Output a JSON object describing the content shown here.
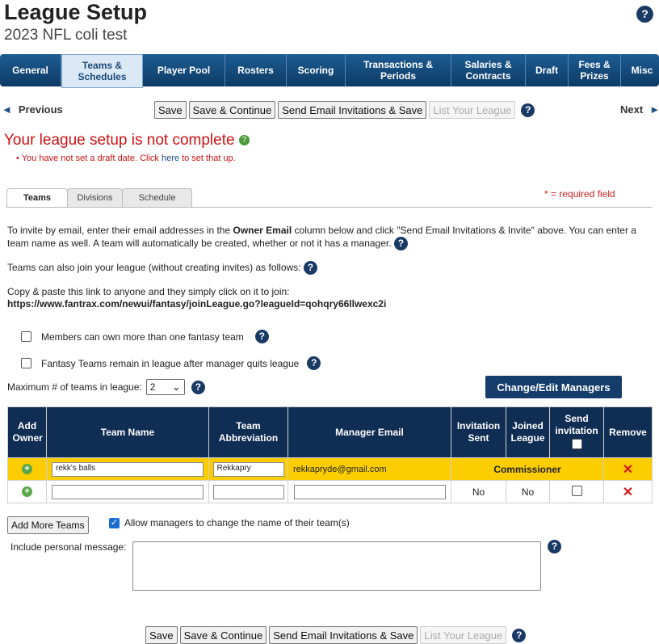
{
  "header": {
    "title": "League Setup",
    "subtitle": "2023 NFL coli test"
  },
  "icons": {
    "help": "?",
    "ok": "?",
    "plus": "+",
    "remove": "✕",
    "prev_arrow": "◄",
    "next_arrow": "►",
    "dropdown": "⌄"
  },
  "nav": [
    {
      "label": "General",
      "active": false
    },
    {
      "label": "Teams & Schedules",
      "active": true
    },
    {
      "label": "Player Pool",
      "active": false
    },
    {
      "label": "Rosters",
      "active": false
    },
    {
      "label": "Scoring",
      "active": false
    },
    {
      "label": "Transactions & Periods",
      "active": false
    },
    {
      "label": "Salaries & Contracts",
      "active": false
    },
    {
      "label": "Draft",
      "active": false
    },
    {
      "label": "Fees & Prizes",
      "active": false
    },
    {
      "label": "Misc",
      "active": false
    }
  ],
  "actions": {
    "previous": "Previous",
    "next": "Next",
    "save": "Save",
    "save_continue": "Save & Continue",
    "send_email": "Send Email Invitations & Save",
    "list_league": "List Your League"
  },
  "error": {
    "title": "Your league setup is not complete",
    "item_pre": "You have not set a draft date. Click",
    "item_link": "here",
    "item_post": "to set that up."
  },
  "tabs": [
    {
      "label": "Teams"
    },
    {
      "label": "Divisions"
    },
    {
      "label": "Schedule"
    }
  ],
  "required_note": "* = required field",
  "info": {
    "p1_pre": "To invite by email, enter their email addresses in the",
    "p1_bold": "Owner Email",
    "p1_mid": "column below and click \"Send Email Invitations & Invite\" above. You can enter a",
    "p1_line2": "team name as well. A team will automatically be created, whether or not it has a manager.",
    "p2": "Teams can also join your league (without creating invites) as follows:",
    "p3": "Copy & paste this link to anyone and they simply click on it to join:",
    "link": "https://www.fantrax.com/newui/fantasy/joinLeague.go?leagueId=qohqry66llwexc2i"
  },
  "options": {
    "multi_team": "Members can own more than one fantasy team",
    "remain": "Fantasy Teams remain in league after manager quits league"
  },
  "max_teams": {
    "label": "Maximum # of teams in league:",
    "value": "2"
  },
  "managers_button": "Change/Edit Managers",
  "table": {
    "headers": {
      "add_owner": "Add Owner",
      "team_name": "Team Name",
      "team_abbr": "Team Abbreviation",
      "manager_email": "Manager Email",
      "invitation_sent": "Invitation Sent",
      "joined_league": "Joined League",
      "send_invitation": "Send invitation",
      "remove": "Remove"
    },
    "rows": [
      {
        "team_name": "rekk's balls",
        "abbr": "Rekkapry",
        "email": "rekkapryde@gmail.com",
        "status": "Commissioner"
      },
      {
        "team_name": "",
        "abbr": "",
        "email": "",
        "invitation_sent": "No",
        "joined": "No"
      }
    ]
  },
  "add_more": "Add More Teams",
  "allow_rename": "Allow managers to change the name of their team(s)",
  "personal_message_label": "Include personal message:"
}
